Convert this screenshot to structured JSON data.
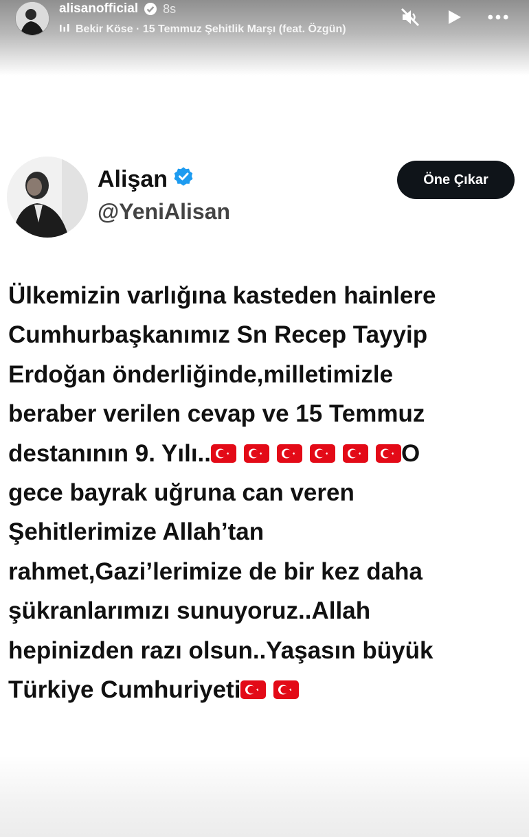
{
  "story": {
    "username": "alisanofficial",
    "time": "8s",
    "music": "Bekir Köse · 15 Temmuz Şehitlik Marşı (feat. Özgün)",
    "icons": [
      "mute-icon",
      "play-icon",
      "more-icon"
    ]
  },
  "tweet": {
    "display_name": "Alişan",
    "handle": "@YeniAlisan",
    "feature_label": "Öne Çıkar",
    "lines": [
      "Ülkemizin varlığına kasteden hainlere",
      "Cumhurbaşkanımız Sn Recep Tayyip",
      "Erdoğan önderliğinde,milletimizle",
      "beraber verilen cevap ve 15 Temmuz",
      "destanının 9. Yılı..",
      "O",
      "gece bayrak uğruna can veren",
      "Şehitlerimize Allah’tan",
      "rahmet,Gazi’lerimize de bir kez daha",
      "şükranlarımızı sunuyoruz..Allah",
      "hepinizden razı olsun..Yaşasın büyük",
      "Türkiye Cumhuriyeti"
    ]
  },
  "colors": {
    "verified": "#1d9bf0",
    "button_bg": "#0f1419",
    "flag_red": "#e30a17"
  }
}
